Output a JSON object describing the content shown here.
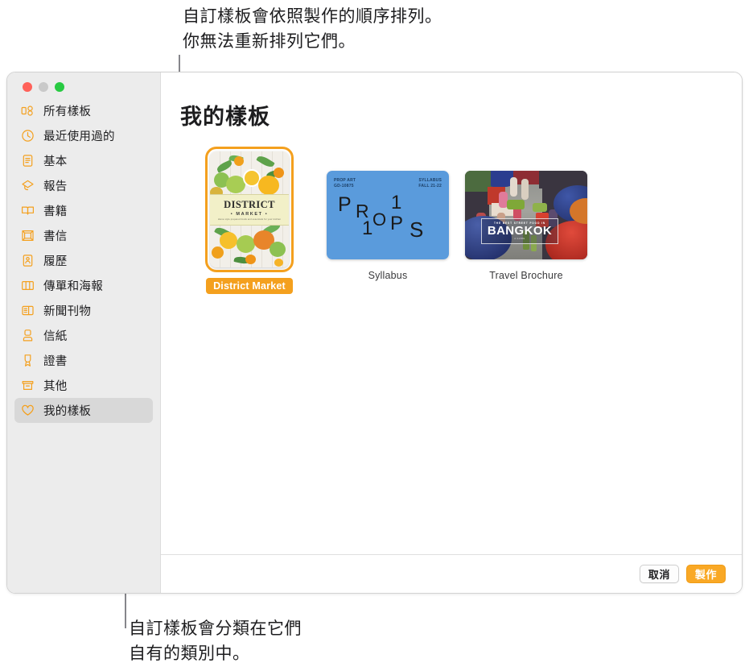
{
  "callouts": {
    "top": "自訂樣板會依照製作的順序排列。\n你無法重新排列它們。",
    "bottom": "自訂樣板會分類在它們\n自有的類別中。"
  },
  "window": {
    "traffic_lights": [
      "close",
      "minimize",
      "zoom"
    ]
  },
  "sidebar": {
    "items": [
      {
        "label": "所有樣板",
        "icon": "all-templates-icon",
        "selected": false
      },
      {
        "label": "最近使用過的",
        "icon": "clock-icon",
        "selected": false
      },
      {
        "label": "基本",
        "icon": "document-icon",
        "selected": false
      },
      {
        "label": "報告",
        "icon": "graduation-cap-icon",
        "selected": false
      },
      {
        "label": "書籍",
        "icon": "book-icon",
        "selected": false
      },
      {
        "label": "書信",
        "icon": "letter-icon",
        "selected": false
      },
      {
        "label": "履歷",
        "icon": "resume-icon",
        "selected": false
      },
      {
        "label": "傳單和海報",
        "icon": "flyer-icon",
        "selected": false
      },
      {
        "label": "新聞刊物",
        "icon": "newsletter-icon",
        "selected": false
      },
      {
        "label": "信紙",
        "icon": "stationery-icon",
        "selected": false
      },
      {
        "label": "證書",
        "icon": "certificate-icon",
        "selected": false
      },
      {
        "label": "其他",
        "icon": "other-icon",
        "selected": false
      },
      {
        "label": "我的樣板",
        "icon": "heart-icon",
        "selected": true
      }
    ]
  },
  "main": {
    "title": "我的樣板",
    "templates": [
      {
        "name": "District Market",
        "orientation": "portrait",
        "selected": true,
        "art": {
          "kind": "district-market",
          "title": "DISTRICT",
          "subtitle": "• MARKET •",
          "tagline": "Home style prepared foods and essentials for your kitchen"
        }
      },
      {
        "name": "Syllabus",
        "orientation": "landscape",
        "selected": false,
        "art": {
          "kind": "syllabus",
          "background": "#5a9bdc",
          "meta_left": "PROP ART\nGD-10875",
          "meta_right": "SYLLABUS\nFALL 21-22",
          "letters": [
            "P",
            "R",
            "O",
            "P",
            "S",
            "1",
            "0",
            "1"
          ]
        }
      },
      {
        "name": "Travel Brochure",
        "orientation": "landscape",
        "selected": false,
        "art": {
          "kind": "travel-brochure",
          "kicker": "THE BEST STREET FOOD IN",
          "city": "BANGKOK",
          "footer": "A GUIDE"
        }
      }
    ]
  },
  "footer": {
    "cancel_label": "取消",
    "create_label": "製作"
  },
  "colors": {
    "accent_orange": "#f4a01e",
    "create_button": "#f9a825",
    "sidebar_bg": "#ececec",
    "selection_bg": "#d8d8d8",
    "syllabus_blue": "#5a9bdc"
  }
}
